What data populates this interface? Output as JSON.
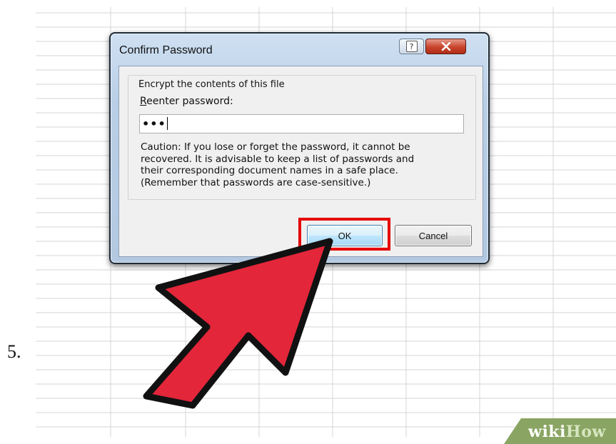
{
  "step": {
    "number": "5."
  },
  "dialog": {
    "title": "Confirm Password",
    "help_label": "?",
    "group_title": "Encrypt the contents of this file",
    "field_label_mnemonic": "R",
    "field_label_rest": "eenter password:",
    "password_value": "•••",
    "caution_lines": [
      "Caution: If you lose or forget the password, it cannot be",
      "recovered. It is advisable to keep a list of passwords and",
      "their corresponding document names in a safe place.",
      "(Remember that passwords are case-sensitive.)"
    ],
    "ok_label": "OK",
    "cancel_label": "Cancel"
  },
  "annotation": {
    "highlight_color": "#e60000",
    "arrow_color": "#e3263a",
    "arrow_icon": "red-pointer-arrow-icon"
  },
  "watermark": {
    "wiki": "wiki",
    "how": "How"
  }
}
